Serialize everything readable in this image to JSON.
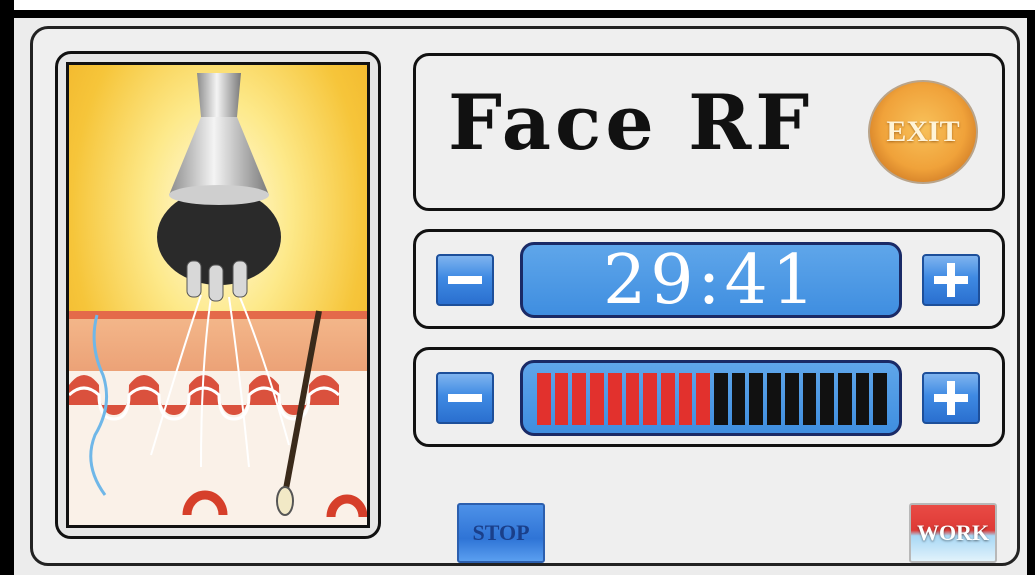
{
  "title": "Face RF",
  "exit_label": "EXIT",
  "timer": {
    "value": "29:41",
    "decrease_icon": "minus-icon",
    "increase_icon": "plus-icon"
  },
  "level": {
    "active_segments": 10,
    "total_segments": 20,
    "active_color": "#e2312d",
    "inactive_color": "#111111",
    "decrease_icon": "minus-icon",
    "increase_icon": "plus-icon"
  },
  "stop_label": "STOP",
  "work_label": "WORK",
  "colors": {
    "button_blue": "#3f8ae3",
    "display_blue": "#4a96e4",
    "exit_orange": "#f0a23a",
    "work_red": "#de3a36"
  }
}
